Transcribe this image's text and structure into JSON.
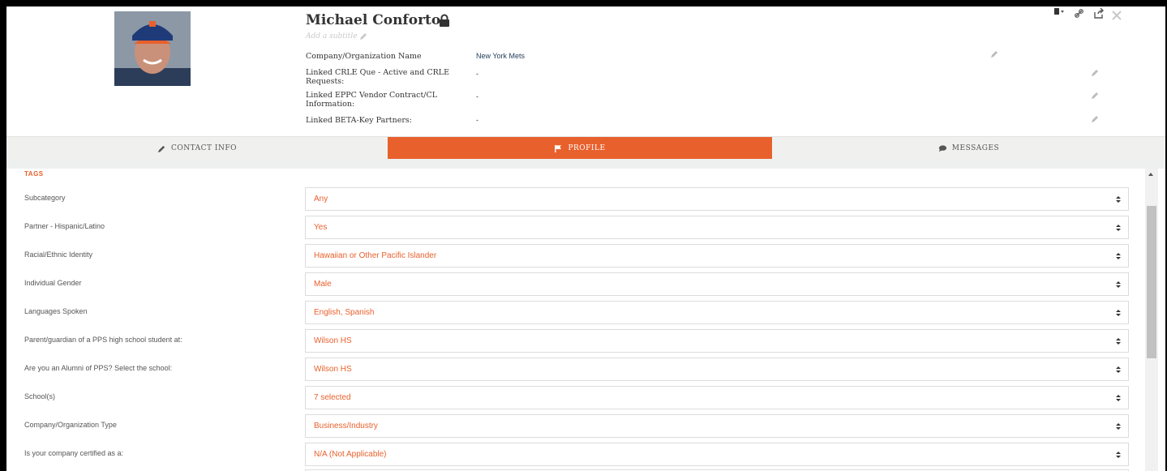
{
  "contact": {
    "name": "Michael Conforto",
    "subtitle_placeholder": "Add a subtitle",
    "fields": [
      {
        "label": "Company/Organization Name",
        "value": "New York Mets"
      },
      {
        "label": "Linked CRLE Que - Active and CRLE Requests:",
        "value": "-"
      },
      {
        "label": "Linked EPPC Vendor Contract/CL Information:",
        "value": "-"
      },
      {
        "label": "Linked BETA-Key Partners:",
        "value": "-"
      }
    ]
  },
  "tabs": [
    {
      "label": "CONTACT INFO",
      "icon": "pencil-icon"
    },
    {
      "label": "PROFILE",
      "icon": "flag-icon"
    },
    {
      "label": "MESSAGES",
      "icon": "message-icon"
    }
  ],
  "active_tab": "PROFILE",
  "section_title": "TAGS",
  "rows": [
    {
      "label": "Subcategory",
      "value": "Any"
    },
    {
      "label": "Partner - Hispanic/Latino",
      "value": "Yes"
    },
    {
      "label": "Racial/Ethnic Identity",
      "value": "Hawaiian or Other Pacific Islander"
    },
    {
      "label": "Individual Gender",
      "value": "Male"
    },
    {
      "label": "Languages Spoken",
      "value": "English, Spanish"
    },
    {
      "label": "Parent/guardian of a PPS high school student at:",
      "value": "Wilson HS"
    },
    {
      "label": "Are you an Alumni of PPS? Select the school:",
      "value": "Wilson HS"
    },
    {
      "label": "School(s)",
      "value": "7 selected"
    },
    {
      "label": "Company/Organization Type",
      "value": "Business/Industry"
    },
    {
      "label": "Is your company certified as a:",
      "value": "N/A (Not Applicable)"
    }
  ],
  "colors": {
    "accent": "#e8602c",
    "tab_bar": "#f0f1ef"
  }
}
